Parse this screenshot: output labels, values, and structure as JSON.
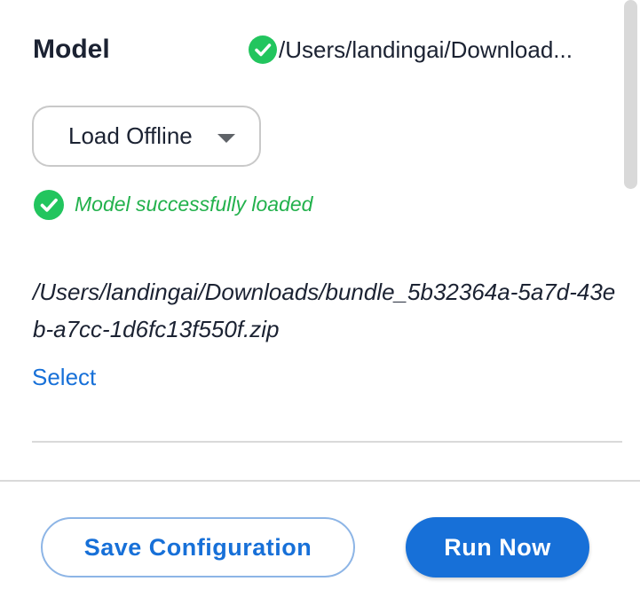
{
  "model_section": {
    "title": "Model",
    "header_path": "/Users/landingai/Download...",
    "status_icon": "check-circle-icon"
  },
  "load_select": {
    "value": "Load Offline",
    "caret_icon": "caret-down-icon"
  },
  "status": {
    "message": "Model successfully loaded",
    "icon": "check-circle-icon"
  },
  "file": {
    "path": "/Users/landingai/Downloads/bundle_5b32364a-5a7d-43eb-a7cc-1d6fc13f550f.zip",
    "select_label": "Select"
  },
  "footer": {
    "save_label": "Save Configuration",
    "run_label": "Run Now"
  },
  "colors": {
    "accent": "#1770d8",
    "success": "#22b14c",
    "text": "#1b2232",
    "border": "#c9c9c9"
  }
}
